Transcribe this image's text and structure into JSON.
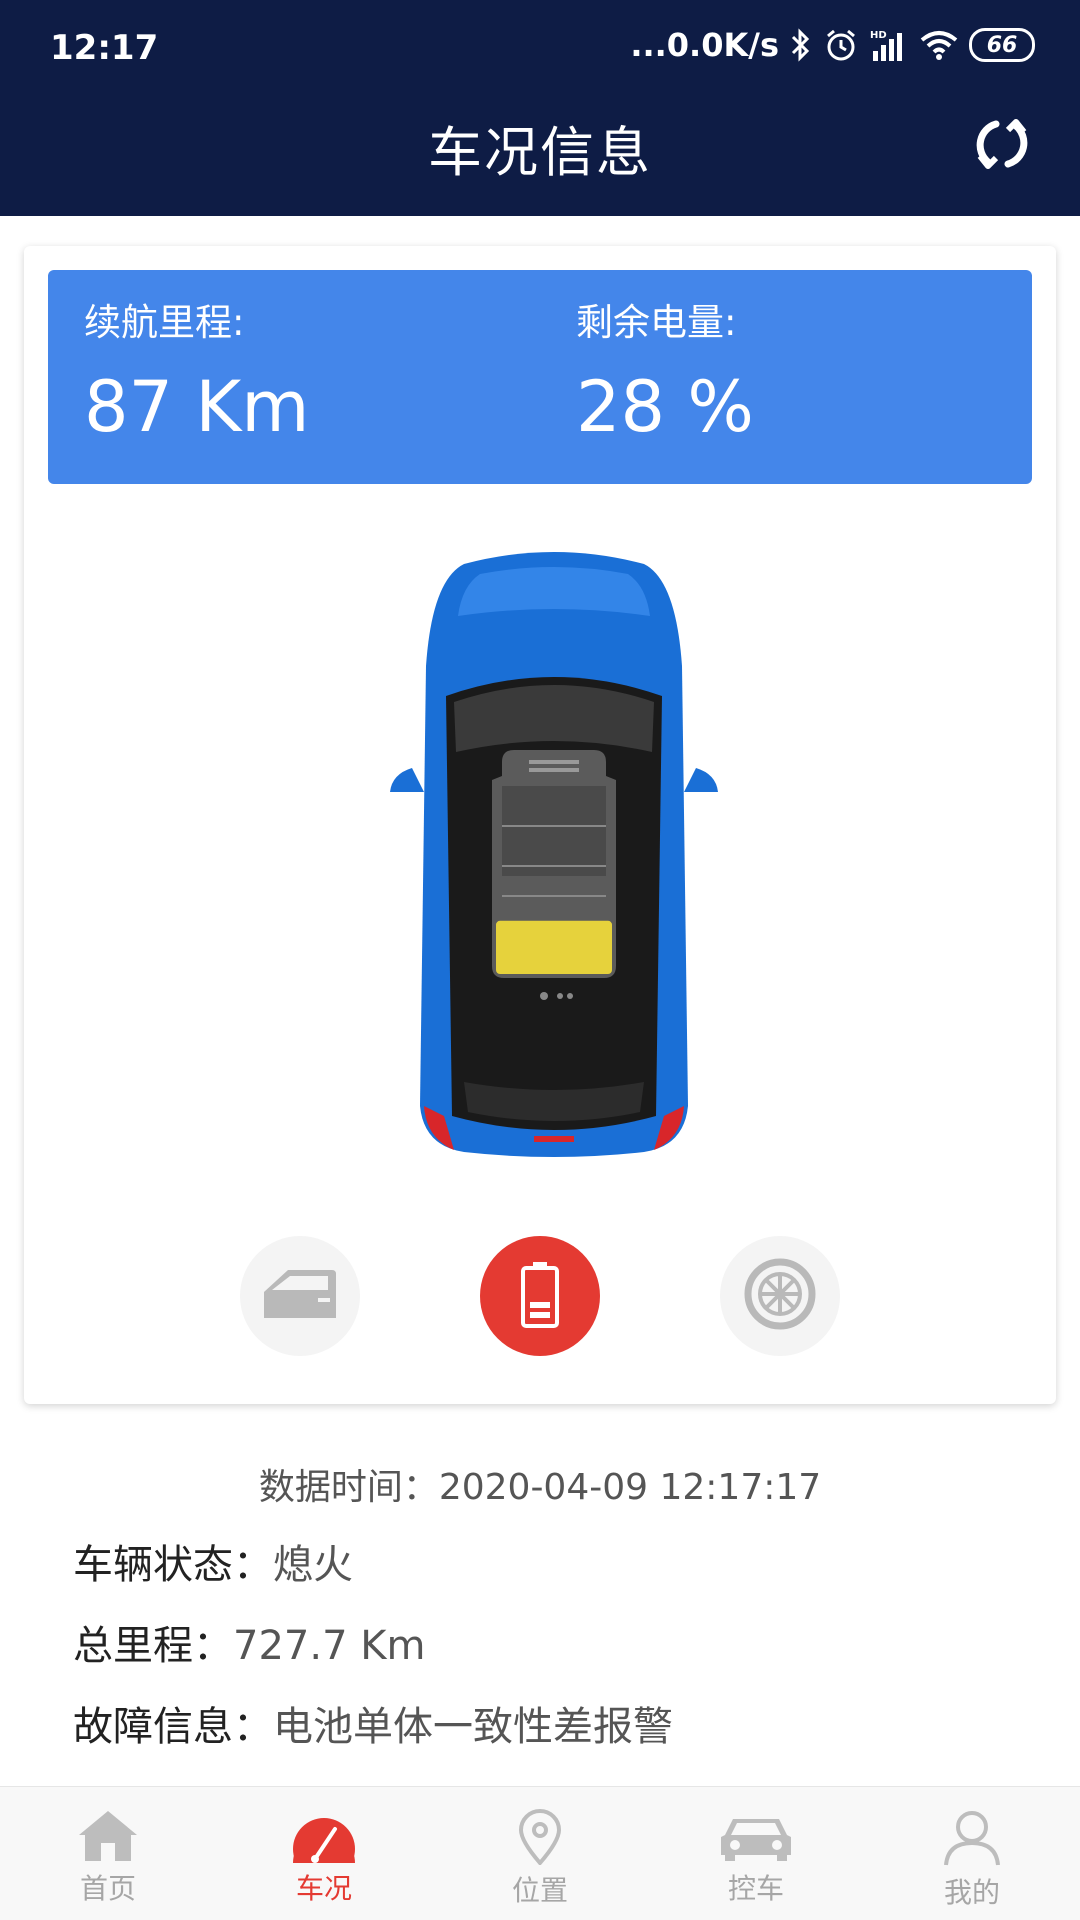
{
  "statusbar": {
    "time": "12:17",
    "network_speed": "...0.0K/s",
    "battery": "66",
    "icons": [
      "bluetooth-icon",
      "alarm-icon",
      "signal-icon",
      "wifi-icon",
      "battery-icon"
    ]
  },
  "header": {
    "title": "车况信息",
    "refresh_icon": "refresh-icon"
  },
  "stats": {
    "range_label": "续航里程:",
    "range_value": "87 Km",
    "battery_label": "剩余电量:",
    "battery_value": "28 %",
    "battery_level_percent": 28
  },
  "view_tabs": [
    {
      "name": "door-icon",
      "active": false
    },
    {
      "name": "battery-icon",
      "active": true
    },
    {
      "name": "tire-icon",
      "active": false
    }
  ],
  "info": {
    "data_time_label": "数据时间：",
    "data_time_value": "2020-04-09 12:17:17",
    "vehicle_status_label": "车辆状态：",
    "vehicle_status_value": "熄火",
    "total_mileage_label": "总里程：",
    "total_mileage_value": "727.7 Km",
    "fault_label": "故障信息：",
    "fault_value": "电池单体一致性差报警"
  },
  "bottom_nav": [
    {
      "label": "首页",
      "icon": "home-icon",
      "active": false
    },
    {
      "label": "车况",
      "icon": "gauge-icon",
      "active": true
    },
    {
      "label": "位置",
      "icon": "location-icon",
      "active": false
    },
    {
      "label": "控车",
      "icon": "car-icon",
      "active": false
    },
    {
      "label": "我的",
      "icon": "user-icon",
      "active": false
    }
  ],
  "colors": {
    "header_bg": "#0e1c45",
    "stats_bg": "#4486ea",
    "active_red": "#e43a32",
    "car_blue": "#1a6fd6",
    "battery_fill": "#e6d23c"
  }
}
